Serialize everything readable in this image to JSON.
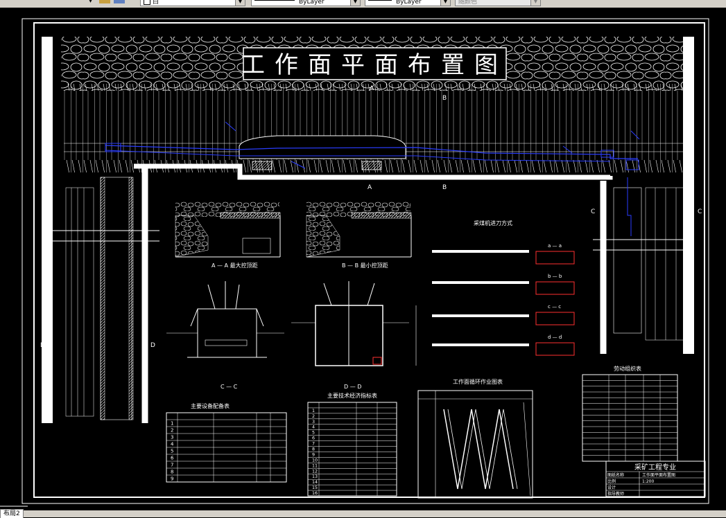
{
  "toolbar": {
    "color_combo": "白",
    "linetype_combo": "ByLayer",
    "lineweight_combo": "ByLayer",
    "plotstyle_combo": "随颜色"
  },
  "drawing": {
    "title": "工作面平面布置图",
    "section_labels": {
      "a": "A",
      "b": "B",
      "c": "C",
      "d": "D"
    },
    "section_titles": {
      "aa": "A — A  最大控顶距",
      "bb": "B — B  最小控顶距",
      "cc": "C — C",
      "dd": "D — D"
    },
    "mining_method_title": "采煤机进刀方式",
    "cutting_steps": [
      "a — a",
      "b — b",
      "c — c",
      "d — d"
    ],
    "cycle_chart_title": "工作面循环作业图表",
    "table_left_title": "主要设备配备表",
    "table_middle_title": "主要技术经济指标表",
    "table_right_title": "劳动组织表",
    "table_left_rows": [
      "1",
      "2",
      "3",
      "4",
      "5",
      "6",
      "7",
      "8",
      "9"
    ],
    "table_middle_rows": [
      "1",
      "2",
      "3",
      "4",
      "5",
      "6",
      "7",
      "8",
      "9",
      "10",
      "11",
      "12",
      "13",
      "14",
      "15",
      "16"
    ],
    "title_block": {
      "school": "采矿工程专业",
      "row_labels": [
        "图纸名称",
        "比例",
        "设计",
        "指导教师"
      ],
      "drawing_name": "工作面平面布置图",
      "scale": "1:200"
    }
  },
  "layout_tab": "布局2"
}
